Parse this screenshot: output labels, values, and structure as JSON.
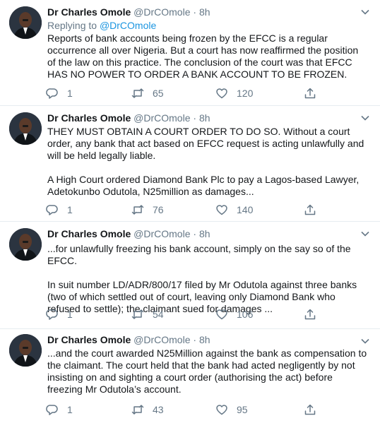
{
  "tweets": [
    {
      "name": "Dr Charles Omole",
      "handle": "@DrCOmole",
      "sep": "·",
      "time": "8h",
      "replying_prefix": "Replying to",
      "replying_to": "@DrCOmole",
      "text": "Reports of bank accounts being frozen by the EFCC is a regular occurrence all over Nigeria. But a court has now reaffirmed the position of the law on this practice. The conclusion of the court was that EFCC HAS NO POWER TO ORDER A BANK ACCOUNT TO BE FROZEN.",
      "replies": "1",
      "retweets": "65",
      "likes": "120"
    },
    {
      "name": "Dr Charles Omole",
      "handle": "@DrCOmole",
      "sep": "·",
      "time": "8h",
      "text": "THEY MUST OBTAIN A COURT ORDER TO DO SO. Without a court order, any bank that act based on EFCC request is acting unlawfully and will be held legally liable.\n\nA High Court ordered Diamond Bank Plc to pay a Lagos-based Lawyer, Adetokunbo Odutola, N25million as damages...",
      "replies": "1",
      "retweets": "76",
      "likes": "140"
    },
    {
      "name": "Dr Charles Omole",
      "handle": "@DrCOmole",
      "sep": "·",
      "time": "8h",
      "text": "...for unlawfully freezing his bank account, simply on the say so of the EFCC.\n\nIn suit number LD/ADR/800/17 filed by Mr Odutola against three banks (two of which settled out of court, leaving only Diamond Bank who refused to settle); the claimant sued for damages ...",
      "replies": "1",
      "retweets": "54",
      "likes": "106"
    },
    {
      "name": "Dr Charles Omole",
      "handle": "@DrCOmole",
      "sep": "·",
      "time": "8h",
      "text": "...and the court awarded N25Million against the bank as compensation to the claimant. The court held that the bank had acted negligently by not insisting on and sighting a court order (authorising the act) before freezing Mr Odutola’s account.",
      "replies": "1",
      "retweets": "43",
      "likes": "95"
    }
  ],
  "icons": {
    "reply": "reply-icon",
    "retweet": "retweet-icon",
    "like": "heart-icon",
    "share": "share-icon",
    "caret": "chevron-down-icon",
    "avatar": "avatar"
  },
  "colors": {
    "link": "#1b95e0",
    "secondary": "#657786",
    "text": "#14171a",
    "divider": "#e6ecf0"
  }
}
